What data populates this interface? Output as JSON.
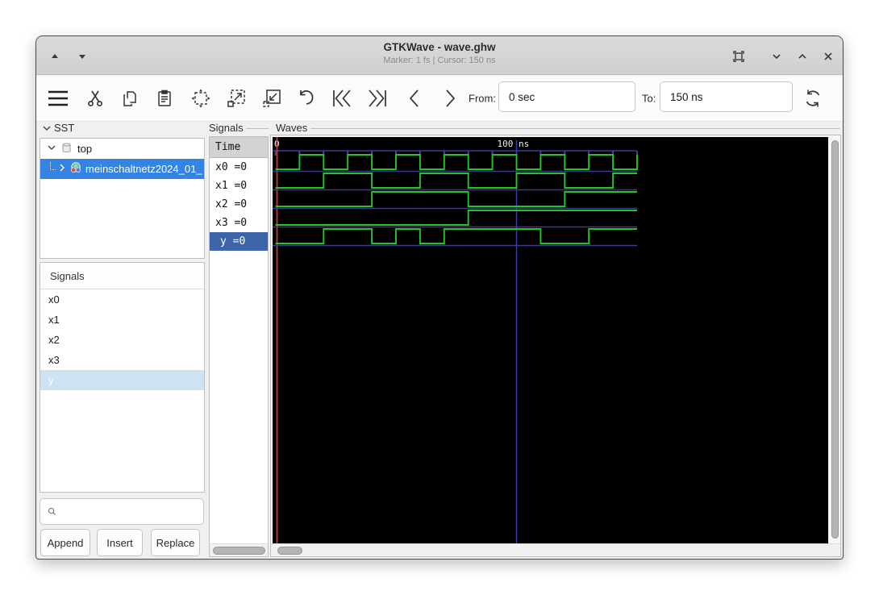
{
  "window": {
    "title": "GTKWave - wave.ghw",
    "subtitle": "Marker: 1 fs  |  Cursor: 150 ns"
  },
  "toolbar": {
    "from_label": "From:",
    "from_value": "0 sec",
    "to_label": "To:",
    "to_value": "150 ns"
  },
  "sst": {
    "header": "SST",
    "tree": [
      {
        "label": "top",
        "expanded": true,
        "icon": "scope-cylinder-icon"
      },
      {
        "label": "meinschaltnetz2024_01_",
        "expanded": false,
        "selected": true,
        "icon": "module-icon"
      }
    ]
  },
  "signal_list": {
    "header": "Signals",
    "items": [
      "x0",
      "x1",
      "x2",
      "x3",
      "y"
    ],
    "selected": "y",
    "search_placeholder": "",
    "buttons": [
      "Append",
      "Insert",
      "Replace"
    ]
  },
  "signals_panel": {
    "frame_label": "Signals",
    "time_header": "Time",
    "rows": [
      "x0 =0",
      "x1 =0",
      "x2 =0",
      "x3 =0",
      "y =0"
    ],
    "selected_row": "y =0"
  },
  "waves_panel": {
    "frame_label": "Waves"
  },
  "chart_data": {
    "type": "line",
    "subtype": "digital-waveform",
    "title": "GTKWave waveforms for wave.ghw",
    "x_unit": "ns",
    "x_range": [
      0,
      150
    ],
    "minor_tick_step_ns": 10,
    "tick_labels": [
      {
        "t": 0,
        "label": "0"
      },
      {
        "t": 100,
        "label": "100 ns"
      }
    ],
    "major_gridline_t": 100,
    "marker": {
      "t": 0,
      "label": "Marker: 1 fs",
      "color": "#cc3b3b"
    },
    "colors": {
      "background": "#000000",
      "trace": "#27c427",
      "separator": "#3b3b8a",
      "tick": "#4646b2",
      "grid": "#3d3dae",
      "timeline_text": "#f0f0f0"
    },
    "signals": [
      {
        "name": "x0",
        "value_at_marker": 0,
        "transitions": [
          [
            0,
            0
          ],
          [
            10,
            1
          ],
          [
            20,
            0
          ],
          [
            30,
            1
          ],
          [
            40,
            0
          ],
          [
            50,
            1
          ],
          [
            60,
            0
          ],
          [
            70,
            1
          ],
          [
            80,
            0
          ],
          [
            90,
            1
          ],
          [
            100,
            0
          ],
          [
            110,
            1
          ],
          [
            120,
            0
          ],
          [
            130,
            1
          ],
          [
            140,
            0
          ],
          [
            150,
            1
          ]
        ]
      },
      {
        "name": "x1",
        "value_at_marker": 0,
        "transitions": [
          [
            0,
            0
          ],
          [
            20,
            1
          ],
          [
            40,
            0
          ],
          [
            60,
            1
          ],
          [
            80,
            0
          ],
          [
            100,
            1
          ],
          [
            120,
            0
          ],
          [
            140,
            1
          ]
        ]
      },
      {
        "name": "x2",
        "value_at_marker": 0,
        "transitions": [
          [
            0,
            0
          ],
          [
            40,
            1
          ],
          [
            80,
            0
          ],
          [
            120,
            1
          ]
        ]
      },
      {
        "name": "x3",
        "value_at_marker": 0,
        "transitions": [
          [
            0,
            0
          ],
          [
            80,
            1
          ]
        ]
      },
      {
        "name": "y",
        "value_at_marker": 0,
        "transitions": [
          [
            0,
            0
          ],
          [
            20,
            1
          ],
          [
            40,
            0
          ],
          [
            50,
            1
          ],
          [
            60,
            0
          ],
          [
            70,
            1
          ],
          [
            110,
            0
          ],
          [
            130,
            1
          ]
        ]
      }
    ]
  }
}
